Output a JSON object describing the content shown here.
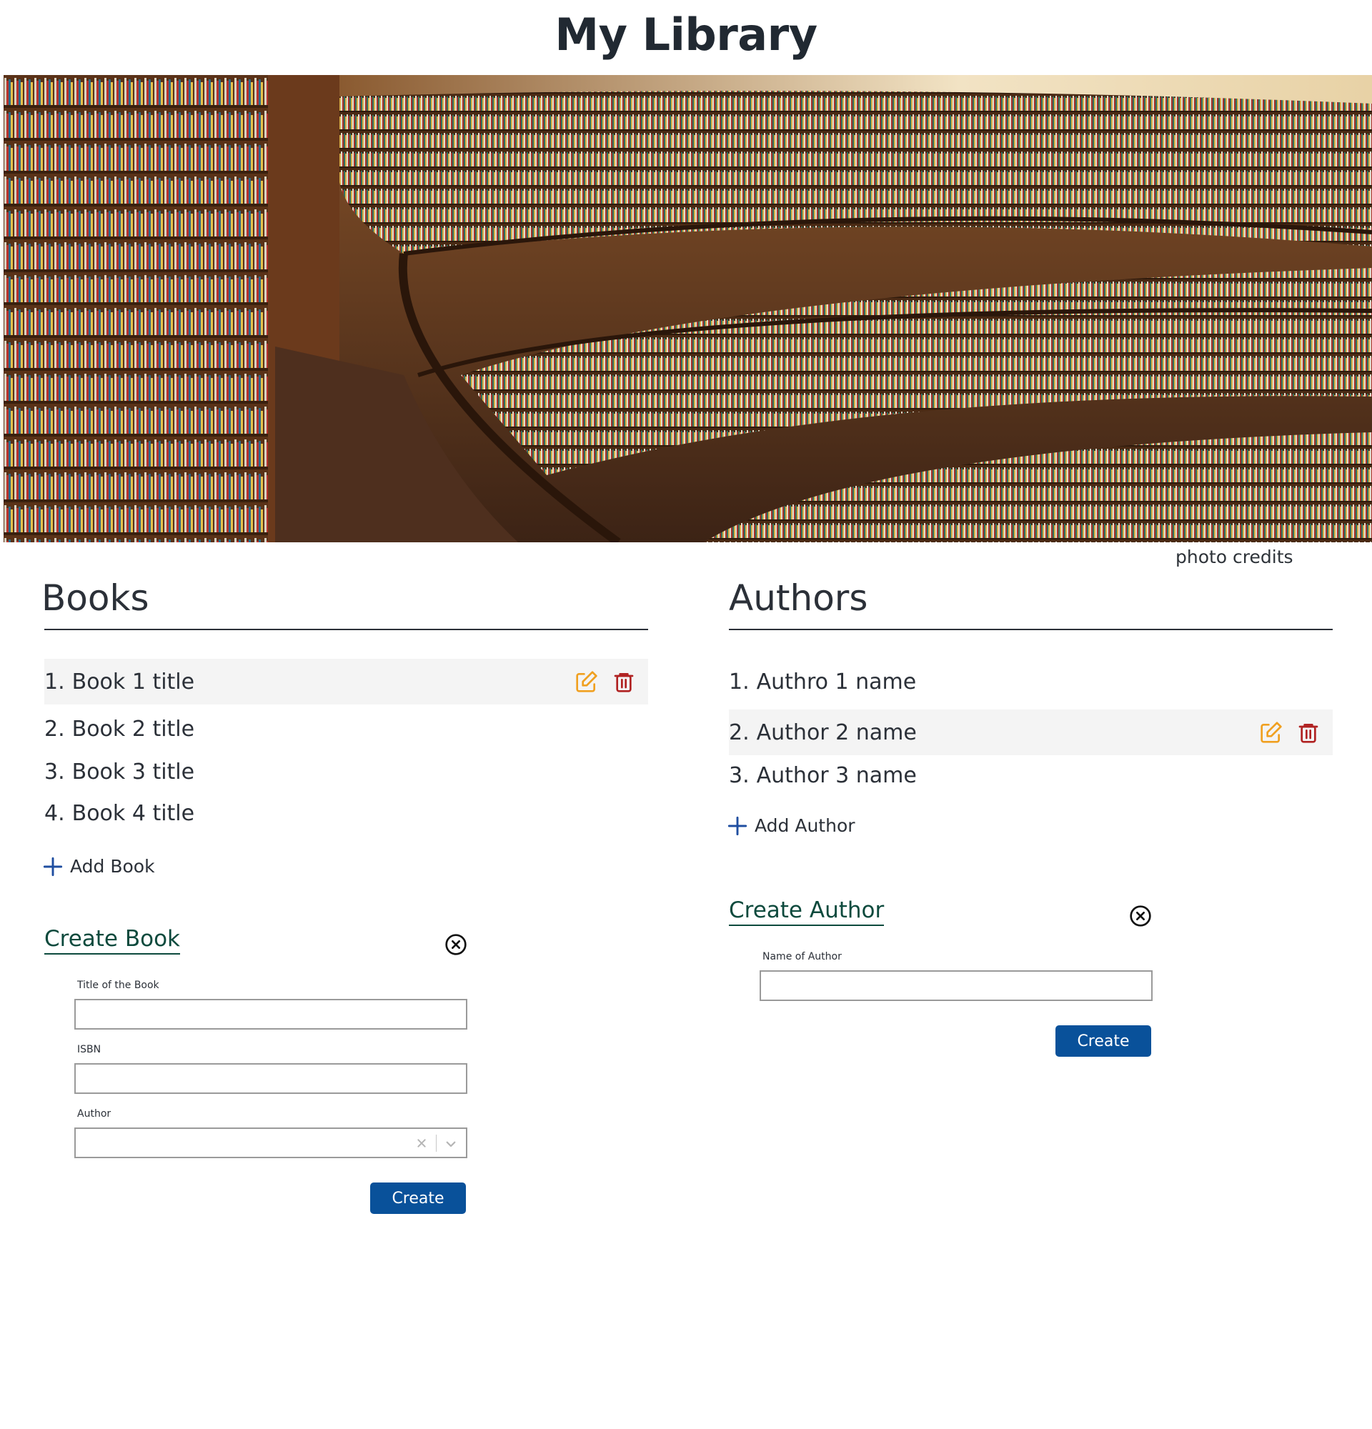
{
  "header": {
    "title": "My Library"
  },
  "hero": {
    "credits_label": "photo credits"
  },
  "books": {
    "title": "Books",
    "items": [
      {
        "num": "1.",
        "label": "Book 1 title"
      },
      {
        "num": "2.",
        "label": "Book 2 title"
      },
      {
        "num": "3.",
        "label": "Book 3 title"
      },
      {
        "num": "4.",
        "label": "Book 4 title"
      }
    ],
    "add_label": "Add Book",
    "form": {
      "title": "Create Book",
      "title_label": "Title of the Book",
      "title_value": "",
      "isbn_label": "ISBN",
      "isbn_value": "",
      "author_label": "Author",
      "author_value": "",
      "submit_label": "Create"
    }
  },
  "authors": {
    "title": "Authors",
    "items": [
      {
        "num": "1.",
        "label": "Authro 1 name"
      },
      {
        "num": "2.",
        "label": "Author 2 name"
      },
      {
        "num": "3.",
        "label": "Author 3 name"
      }
    ],
    "add_label": "Add Author",
    "form": {
      "title": "Create Author",
      "name_label": "Name of Author",
      "name_value": "",
      "submit_label": "Create"
    }
  },
  "icons": {
    "edit": "edit-icon",
    "delete": "trash-icon",
    "add": "plus-icon",
    "close": "close-circle-icon",
    "clear": "clear-icon",
    "dropdown": "chevron-down-icon"
  },
  "colors": {
    "accent": "#09519a",
    "form_title": "#0d4a3d",
    "edit_icon": "#f0a020",
    "delete_icon": "#b02222",
    "add_icon": "#1f4ea0",
    "row_highlight": "#f4f4f4"
  }
}
